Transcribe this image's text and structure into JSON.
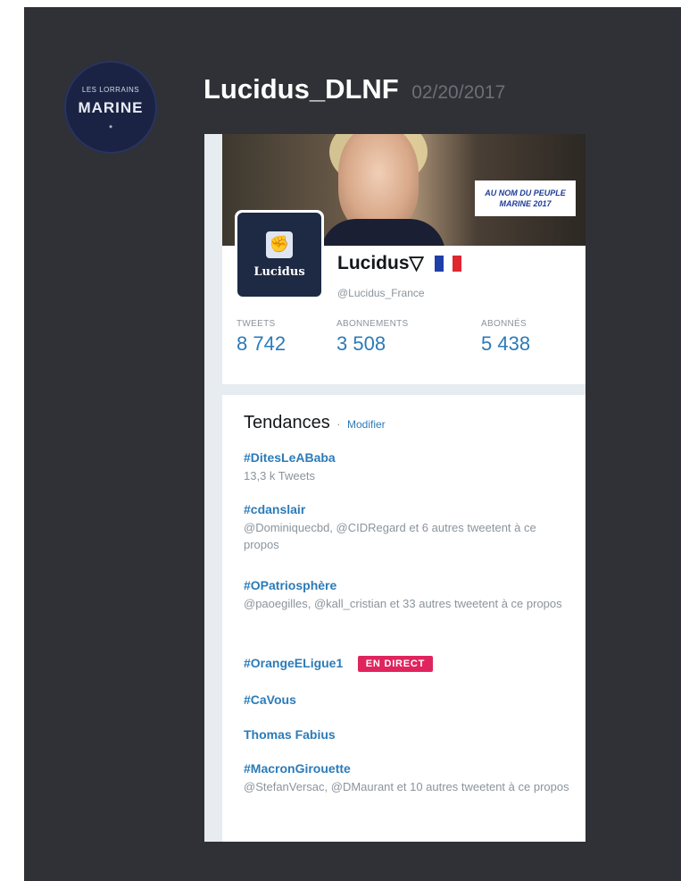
{
  "message": {
    "username": "Lucidus_DLNF",
    "date": "02/20/2017",
    "avatar": {
      "small_text": "LES LORRAINS",
      "big_text": "MARINE",
      "icon": "server-avatar-logo"
    }
  },
  "profile_card": {
    "banner_slogan": [
      "AU NOM DU PEUPLE",
      "MARINE 2017"
    ],
    "logo_text": "Lucidus",
    "display_name": "Lucidus▽",
    "handle": "@Lucidus_France",
    "flag_colors": [
      "#1f3fa8",
      "#ffffff",
      "#e0262f"
    ],
    "stats": [
      {
        "label": "TWEETS",
        "value": "8 742"
      },
      {
        "label": "ABONNEMENTS",
        "value": "3 508"
      },
      {
        "label": "ABONNÉS",
        "value": "5 438"
      }
    ]
  },
  "trends": {
    "title": "Tendances",
    "separator": "·",
    "edit_label": "Modifier",
    "items": [
      {
        "tag": "#DitesLeABaba",
        "meta": "13,3 k Tweets"
      },
      {
        "tag": "#cdanslair",
        "meta": "@Dominiquecbd, @CIDRegard et 6 autres tweetent à ce propos"
      },
      {
        "tag": "#OPatriosphère",
        "meta": "@paoegilles, @kall_cristian et 33 autres tweetent à ce propos"
      },
      {
        "tag": "#OrangeELigue1",
        "badge": "EN DIRECT"
      },
      {
        "tag": "#CaVous"
      },
      {
        "tag": "Thomas Fabius"
      },
      {
        "tag": "#MacronGirouette",
        "meta": "@StefanVersac, @DMaurant et 10 autres tweetent à ce propos"
      }
    ]
  },
  "colors": {
    "link": "#2b7bb9",
    "live_badge": "#e0245e",
    "panel_bg": "#2f3136"
  }
}
